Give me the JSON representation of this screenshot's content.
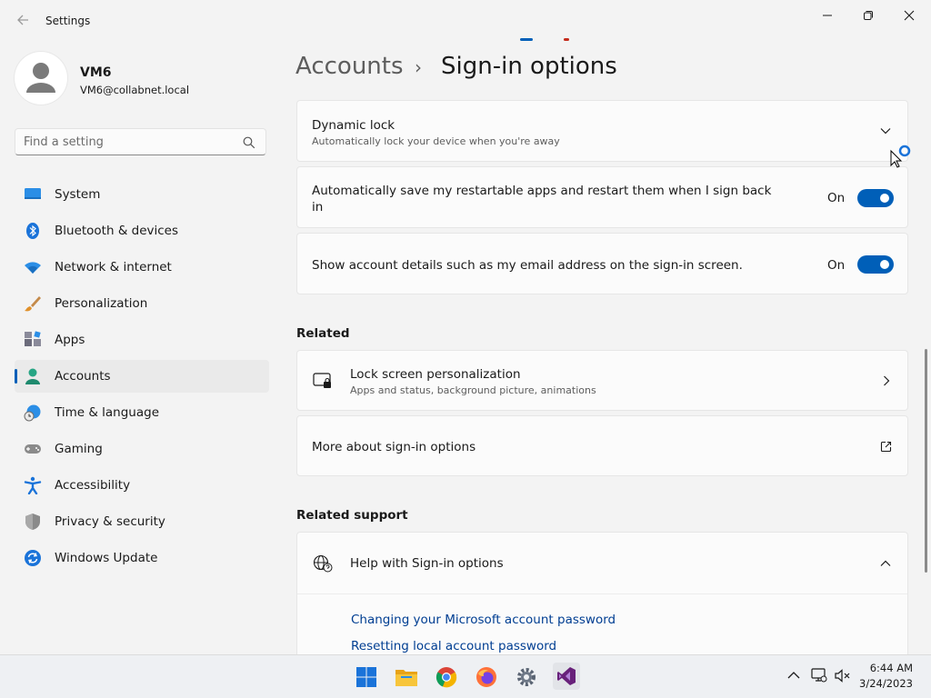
{
  "window": {
    "title": "Settings",
    "back_icon": "back-arrow-icon",
    "controls": [
      "minimize-icon",
      "maximize-icon",
      "close-icon"
    ]
  },
  "profile": {
    "name": "VM6",
    "email": "VM6@collabnet.local"
  },
  "search": {
    "placeholder": "Find a setting"
  },
  "nav": {
    "items": [
      {
        "label": "System",
        "icon": "system-icon"
      },
      {
        "label": "Bluetooth & devices",
        "icon": "bluetooth-icon"
      },
      {
        "label": "Network & internet",
        "icon": "wifi-icon"
      },
      {
        "label": "Personalization",
        "icon": "brush-icon"
      },
      {
        "label": "Apps",
        "icon": "apps-icon"
      },
      {
        "label": "Accounts",
        "icon": "accounts-icon",
        "active": true
      },
      {
        "label": "Time & language",
        "icon": "time-language-icon"
      },
      {
        "label": "Gaming",
        "icon": "gaming-icon"
      },
      {
        "label": "Accessibility",
        "icon": "accessibility-icon"
      },
      {
        "label": "Privacy & security",
        "icon": "shield-icon"
      },
      {
        "label": "Windows Update",
        "icon": "update-icon"
      }
    ]
  },
  "breadcrumb": {
    "parent": "Accounts",
    "separator": "›",
    "current": "Sign-in options"
  },
  "settings": {
    "dynamic_lock": {
      "title": "Dynamic lock",
      "subtitle": "Automatically lock your device when you're away"
    },
    "restart_apps": {
      "title_line1": "Automatically save my restartable apps and restart them when I sign back",
      "title_line2": "in",
      "state": "On"
    },
    "account_details": {
      "title": "Show account details such as my email address on the sign-in screen.",
      "state": "On"
    }
  },
  "related": {
    "heading": "Related",
    "lock_screen": {
      "title": "Lock screen personalization",
      "subtitle": "Apps and status, background picture, animations"
    },
    "more_signin": {
      "title": "More about sign-in options"
    }
  },
  "related_support": {
    "heading": "Related support",
    "help": {
      "title": "Help with Sign-in options"
    },
    "links": [
      "Changing your Microsoft account password",
      "Resetting local account password"
    ]
  },
  "taskbar": {
    "apps": [
      "windows-start-icon",
      "file-explorer-icon",
      "chrome-icon",
      "firefox-icon",
      "settings-icon",
      "visual-studio-icon"
    ],
    "tray": [
      "chevron-up-icon",
      "network-icon",
      "volume-muted-icon"
    ],
    "time": "6:44 AM",
    "date": "3/24/2023"
  },
  "colors": {
    "accent": "#005fb8",
    "link": "#003e92",
    "background": "#f3f3f3",
    "card": "#fbfbfb"
  }
}
